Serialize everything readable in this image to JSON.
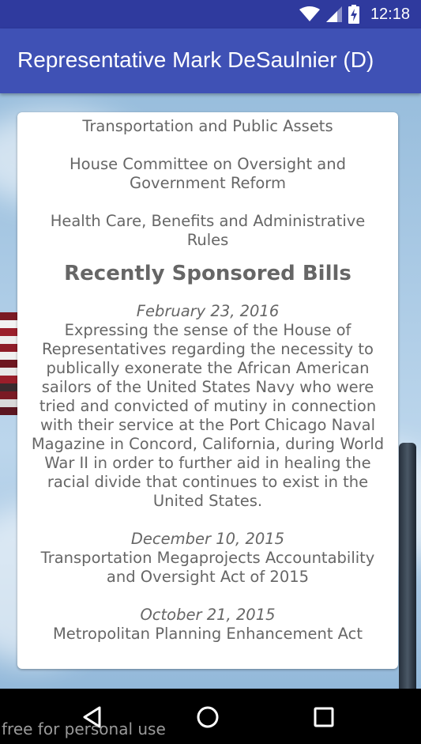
{
  "status_bar": {
    "time": "12:18",
    "icons": [
      "wifi-icon",
      "cell-signal-icon",
      "battery-icon"
    ]
  },
  "app_bar": {
    "title": "Representative Mark DeSaulnier (D)"
  },
  "committees": [
    "Transportation and Public Assets",
    "House Committee on Oversight and Government Reform",
    "Health Care, Benefits and Administrative Rules"
  ],
  "bills_section": {
    "heading": "Recently Sponsored Bills",
    "bills": [
      {
        "date": "February 23, 2016",
        "title": "Expressing the sense of the House of Representatives regarding the necessity to publically exonerate the African American sailors of the United States Navy who were tried and convicted of mutiny in connection with their service at the Port Chicago Naval Magazine in Concord, California, during World War II in order to further aid in healing the racial divide that continues to exist in the United States."
      },
      {
        "date": "December 10, 2015",
        "title": "Transportation Megaprojects Accountability and Oversight Act of 2015"
      },
      {
        "date": "October 21, 2015",
        "title": "Metropolitan Planning Enhancement Act"
      }
    ]
  },
  "nav_bar": {
    "icons": [
      "back-icon",
      "home-icon",
      "recents-icon"
    ]
  },
  "watermark": "free for personal use",
  "colors": {
    "status_bar": "#2f3a9e",
    "app_bar": "#3f51b5",
    "card_text": "#666666"
  }
}
